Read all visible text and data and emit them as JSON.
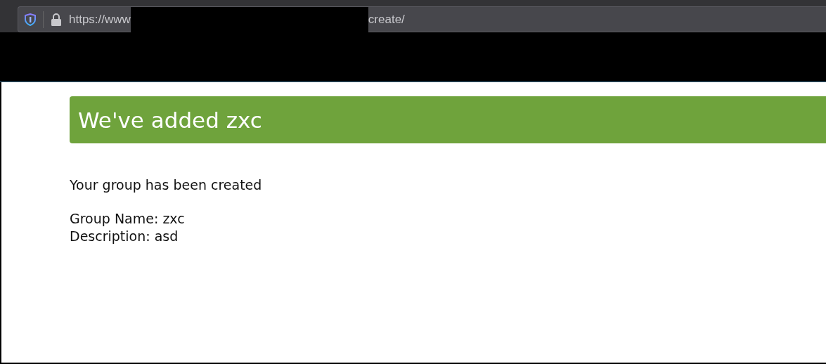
{
  "address_bar": {
    "url_start": "https://www",
    "url_end": "create/",
    "redacted": true
  },
  "alert": {
    "title": "We've added zxc"
  },
  "message": "Your group has been created",
  "details": [
    {
      "label": "Group Name:",
      "value": "zxc"
    },
    {
      "label": "Description:",
      "value": "asd"
    }
  ]
}
